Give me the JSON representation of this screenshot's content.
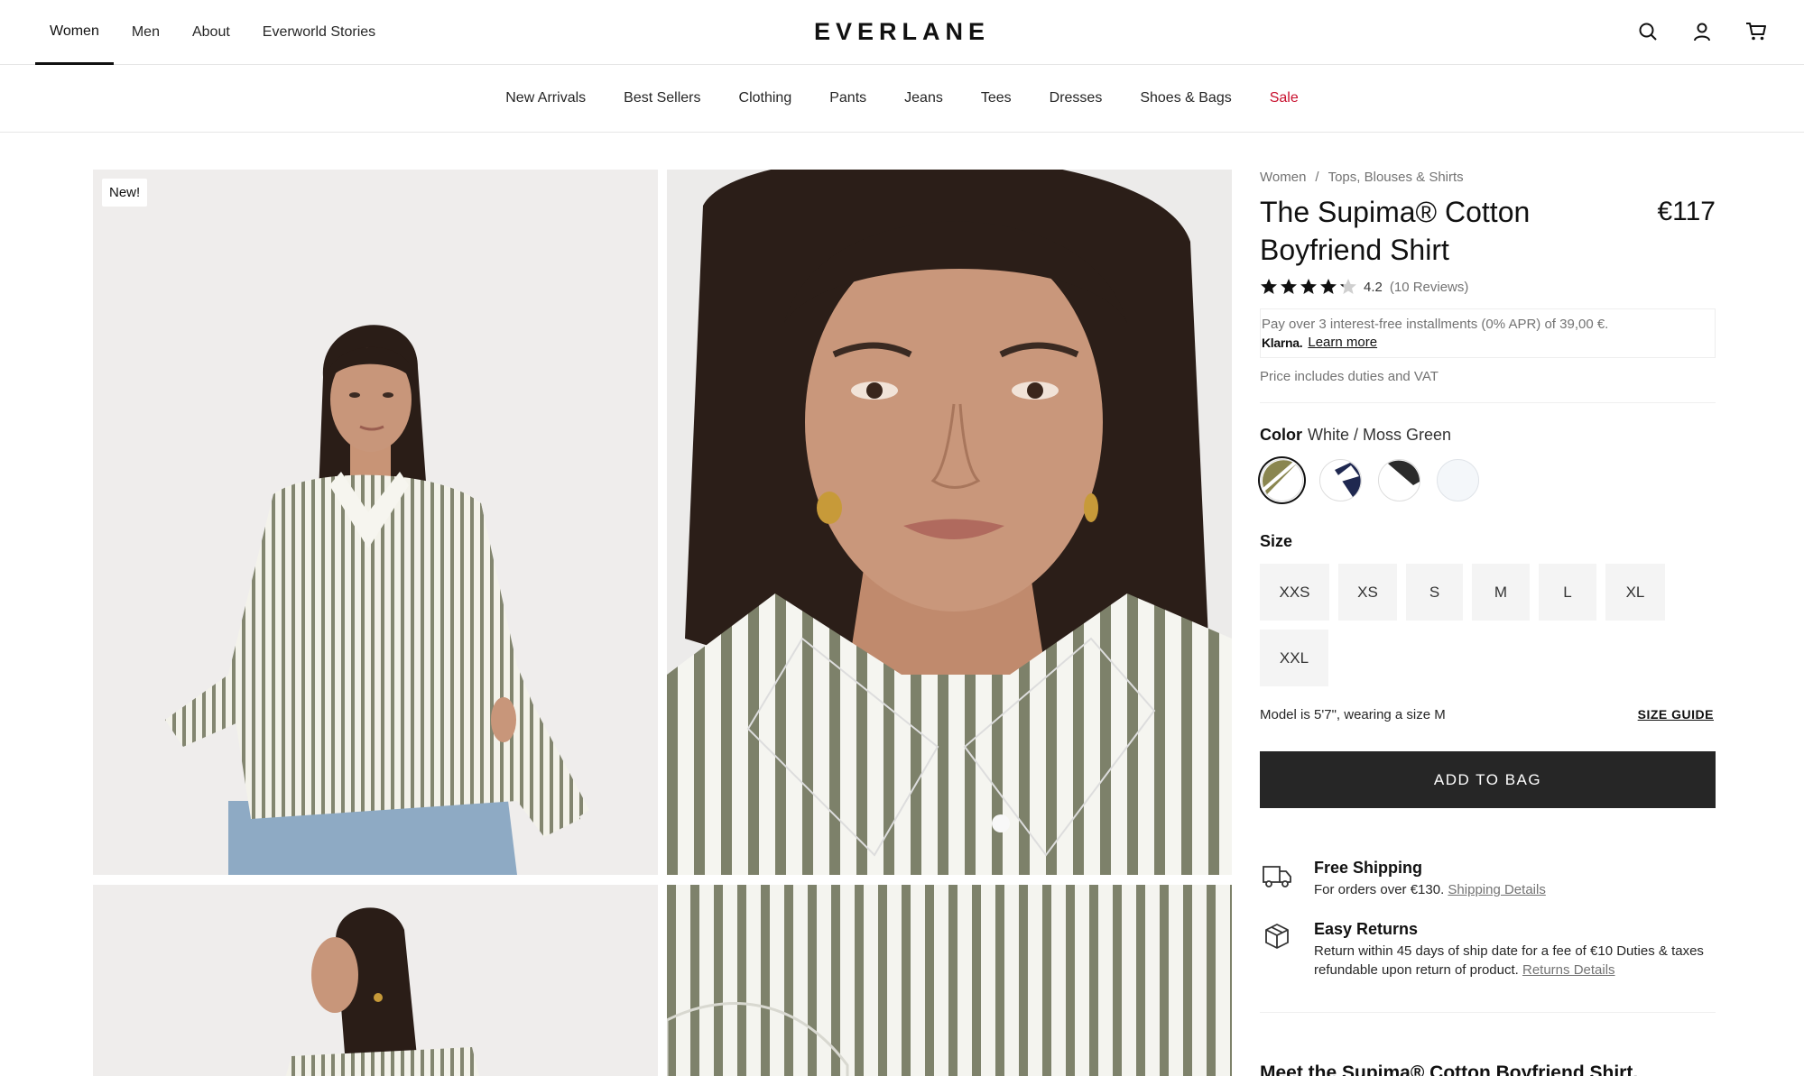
{
  "header": {
    "gender_nav": [
      {
        "label": "Women"
      },
      {
        "label": "Men"
      },
      {
        "label": "About"
      },
      {
        "label": "Everworld Stories"
      }
    ],
    "logo": "EVERLANE",
    "icons": [
      "search-icon",
      "account-icon",
      "cart-icon"
    ]
  },
  "categories": [
    {
      "label": "New Arrivals"
    },
    {
      "label": "Best Sellers"
    },
    {
      "label": "Clothing"
    },
    {
      "label": "Pants"
    },
    {
      "label": "Jeans"
    },
    {
      "label": "Tees"
    },
    {
      "label": "Dresses"
    },
    {
      "label": "Shoes & Bags"
    },
    {
      "label": "Sale"
    }
  ],
  "gallery": {
    "badge": "New!"
  },
  "product": {
    "breadcrumb": [
      "Women",
      "/",
      "Tops, Blouses & Shirts"
    ],
    "title": "The Supima® Cotton Boyfriend Shirt",
    "price": "€117",
    "rating": {
      "stars": 4.2,
      "value": "4.2",
      "count": "(10 Reviews)"
    },
    "klarna": {
      "text": "Pay over 3 interest-free installments (0% APR) of 39,00 €.",
      "logo": "Klarna.",
      "link": "Learn more"
    },
    "duties": "Price includes duties and VAT",
    "color": {
      "label": "Color",
      "selected": "White / Moss Green",
      "swatches": [
        {
          "name": "White / Moss Green",
          "colors": [
            "#ffffff",
            "#8a8650"
          ]
        },
        {
          "name": "White / Navy",
          "colors": [
            "#ffffff",
            "#1f2850"
          ]
        },
        {
          "name": "White / Black",
          "colors": [
            "#ffffff",
            "#2b2b2b"
          ]
        },
        {
          "name": "White",
          "colors": [
            "#f4f7fa",
            "#f4f7fa"
          ]
        }
      ]
    },
    "size": {
      "label": "Size",
      "options": [
        "XXS",
        "XS",
        "S",
        "M",
        "L",
        "XL",
        "XXL"
      ]
    },
    "model_note": "Model is 5'7\", wearing a size M",
    "size_guide": "SIZE GUIDE",
    "add_to_bag": "ADD TO BAG",
    "shipping": {
      "title": "Free Shipping",
      "text": "For orders over €130.",
      "link": "Shipping Details"
    },
    "returns": {
      "title": "Easy Returns",
      "text": "Return within 45 days of ship date for a fee of €10 Duties & taxes refundable upon return of product.",
      "link": "Returns Details"
    },
    "meet": "Meet the Supima® Cotton Boyfriend Shirt."
  },
  "colors": {
    "sale": "#c8102e",
    "button": "#262626",
    "muted": "#737373"
  }
}
